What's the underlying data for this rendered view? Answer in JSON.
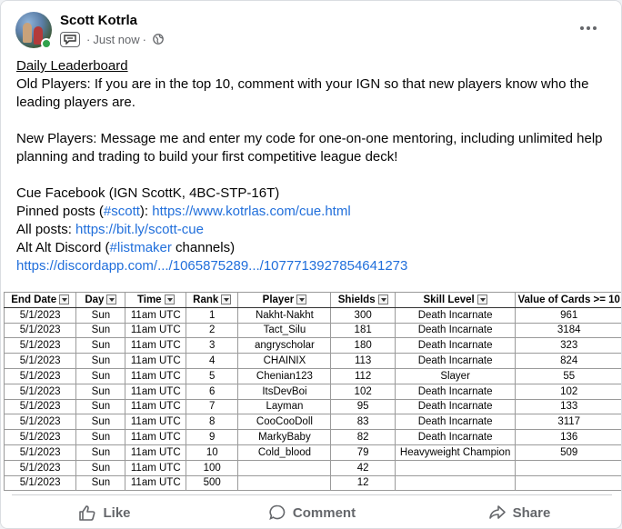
{
  "post": {
    "author": "Scott Kotrla",
    "time": "Just now",
    "separator": "·",
    "lines": {
      "title": "Daily Leaderboard",
      "old_players": "Old Players: If you are in the top 10, comment with your IGN so that new players know who the leading players are.",
      "new_players": "New Players: Message me and enter my code for one-on-one mentoring, including unlimited help planning and trading to build your first competitive league deck!",
      "cue_facebook": "Cue Facebook (IGN ScottK, 4BC-STP-16T)",
      "pinned_prefix": "Pinned posts (",
      "pinned_tag": "#scott",
      "pinned_mid": "): ",
      "pinned_link": "https://www.kotrlas.com/cue.html",
      "all_prefix": "All posts: ",
      "all_link": "https://bit.ly/scott-cue",
      "discord_prefix": "Alt Alt Discord (",
      "discord_tag": "#listmaker",
      "discord_suffix": " channels)",
      "discord_link": "https://discordapp.com/.../1065875289.../1077713927854641273"
    }
  },
  "table": {
    "headers": [
      "End Date",
      "Day",
      "Time",
      "Rank",
      "Player",
      "Shields",
      "Skill Level",
      "Value of Cards >= 10"
    ],
    "rows": [
      [
        "5/1/2023",
        "Sun",
        "11am UTC",
        "1",
        "Nakht-Nakht",
        "300",
        "Death Incarnate",
        "961"
      ],
      [
        "5/1/2023",
        "Sun",
        "11am UTC",
        "2",
        "Tact_Silu",
        "181",
        "Death Incarnate",
        "3184"
      ],
      [
        "5/1/2023",
        "Sun",
        "11am UTC",
        "3",
        "angryscholar",
        "180",
        "Death Incarnate",
        "323"
      ],
      [
        "5/1/2023",
        "Sun",
        "11am UTC",
        "4",
        "CHAINIX",
        "113",
        "Death Incarnate",
        "824"
      ],
      [
        "5/1/2023",
        "Sun",
        "11am UTC",
        "5",
        "Chenian123",
        "112",
        "Slayer",
        "55"
      ],
      [
        "5/1/2023",
        "Sun",
        "11am UTC",
        "6",
        "ItsDevBoi",
        "102",
        "Death Incarnate",
        "102"
      ],
      [
        "5/1/2023",
        "Sun",
        "11am UTC",
        "7",
        "Layman",
        "95",
        "Death Incarnate",
        "133"
      ],
      [
        "5/1/2023",
        "Sun",
        "11am UTC",
        "8",
        "CooCooDoll",
        "83",
        "Death Incarnate",
        "3117"
      ],
      [
        "5/1/2023",
        "Sun",
        "11am UTC",
        "9",
        "MarkyBaby",
        "82",
        "Death Incarnate",
        "136"
      ],
      [
        "5/1/2023",
        "Sun",
        "11am UTC",
        "10",
        "Cold_blood",
        "79",
        "Heavyweight Champion",
        "509"
      ],
      [
        "5/1/2023",
        "Sun",
        "11am UTC",
        "100",
        "",
        "42",
        "",
        ""
      ],
      [
        "5/1/2023",
        "Sun",
        "11am UTC",
        "500",
        "",
        "12",
        "",
        ""
      ]
    ]
  },
  "actions": {
    "like": "Like",
    "comment": "Comment",
    "share": "Share"
  },
  "icons": {
    "more": "more-options-icon",
    "audience": "globe-icon",
    "badge": "chat-badge-icon",
    "like": "thumbs-up-icon",
    "comment": "speech-bubble-icon",
    "share": "share-arrow-icon"
  },
  "colors": {
    "link": "#216fdb",
    "online": "#31a24c",
    "muted": "#65676b"
  }
}
